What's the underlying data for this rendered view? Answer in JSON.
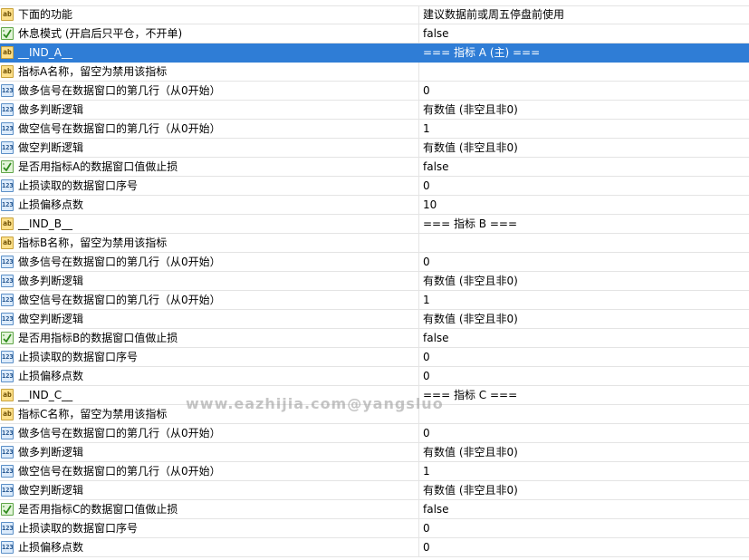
{
  "rows": [
    {
      "type": "ab",
      "name": "下面的功能",
      "value": "建议数据前或周五停盘前使用"
    },
    {
      "type": "bool",
      "name": "休息模式 (开启后只平仓，不开单)",
      "value": "false"
    },
    {
      "type": "ab",
      "name": "__IND_A__",
      "value": "=== 指标 A (主) ===",
      "selected": true
    },
    {
      "type": "ab",
      "name": "指标A名称，留空为禁用该指标",
      "value": ""
    },
    {
      "type": "num",
      "name": "做多信号在数据窗口的第几行（从0开始）",
      "value": "0"
    },
    {
      "type": "num",
      "name": "做多判断逻辑",
      "value": "有数值 (非空且非0)"
    },
    {
      "type": "num",
      "name": "做空信号在数据窗口的第几行（从0开始）",
      "value": "1"
    },
    {
      "type": "num",
      "name": "做空判断逻辑",
      "value": "有数值 (非空且非0)"
    },
    {
      "type": "bool",
      "name": "是否用指标A的数据窗口值做止损",
      "value": "false"
    },
    {
      "type": "num",
      "name": "止损读取的数据窗口序号",
      "value": "0"
    },
    {
      "type": "num",
      "name": "止损偏移点数",
      "value": "10"
    },
    {
      "type": "ab",
      "name": "__IND_B__",
      "value": "=== 指标 B ==="
    },
    {
      "type": "ab",
      "name": "指标B名称，留空为禁用该指标",
      "value": ""
    },
    {
      "type": "num",
      "name": "做多信号在数据窗口的第几行（从0开始）",
      "value": "0"
    },
    {
      "type": "num",
      "name": "做多判断逻辑",
      "value": "有数值 (非空且非0)"
    },
    {
      "type": "num",
      "name": "做空信号在数据窗口的第几行（从0开始）",
      "value": "1"
    },
    {
      "type": "num",
      "name": "做空判断逻辑",
      "value": "有数值 (非空且非0)"
    },
    {
      "type": "bool",
      "name": "是否用指标B的数据窗口值做止损",
      "value": "false"
    },
    {
      "type": "num",
      "name": "止损读取的数据窗口序号",
      "value": "0"
    },
    {
      "type": "num",
      "name": "止损偏移点数",
      "value": "0"
    },
    {
      "type": "ab",
      "name": "__IND_C__",
      "value": "=== 指标 C ==="
    },
    {
      "type": "ab",
      "name": "指标C名称，留空为禁用该指标",
      "value": ""
    },
    {
      "type": "num",
      "name": "做多信号在数据窗口的第几行（从0开始）",
      "value": "0"
    },
    {
      "type": "num",
      "name": "做多判断逻辑",
      "value": "有数值 (非空且非0)"
    },
    {
      "type": "num",
      "name": "做空信号在数据窗口的第几行（从0开始）",
      "value": "1"
    },
    {
      "type": "num",
      "name": "做空判断逻辑",
      "value": "有数值 (非空且非0)"
    },
    {
      "type": "bool",
      "name": "是否用指标C的数据窗口值做止损",
      "value": "false"
    },
    {
      "type": "num",
      "name": "止损读取的数据窗口序号",
      "value": "0"
    },
    {
      "type": "num",
      "name": "止损偏移点数",
      "value": "0"
    }
  ],
  "icons": {
    "ab": "ab",
    "num": "123"
  },
  "icon_names": {
    "ab": "string-param-icon",
    "num": "number-param-icon",
    "bool": "bool-param-icon"
  },
  "watermark": "www.eazhijia.com@yangsluo",
  "colors": {
    "selection": "#2f7dd6",
    "grid_line": "#e4e4e4",
    "string_icon": "#fde08a",
    "number_icon": "#dcebfb",
    "bool_icon": "#e2f4d8"
  }
}
